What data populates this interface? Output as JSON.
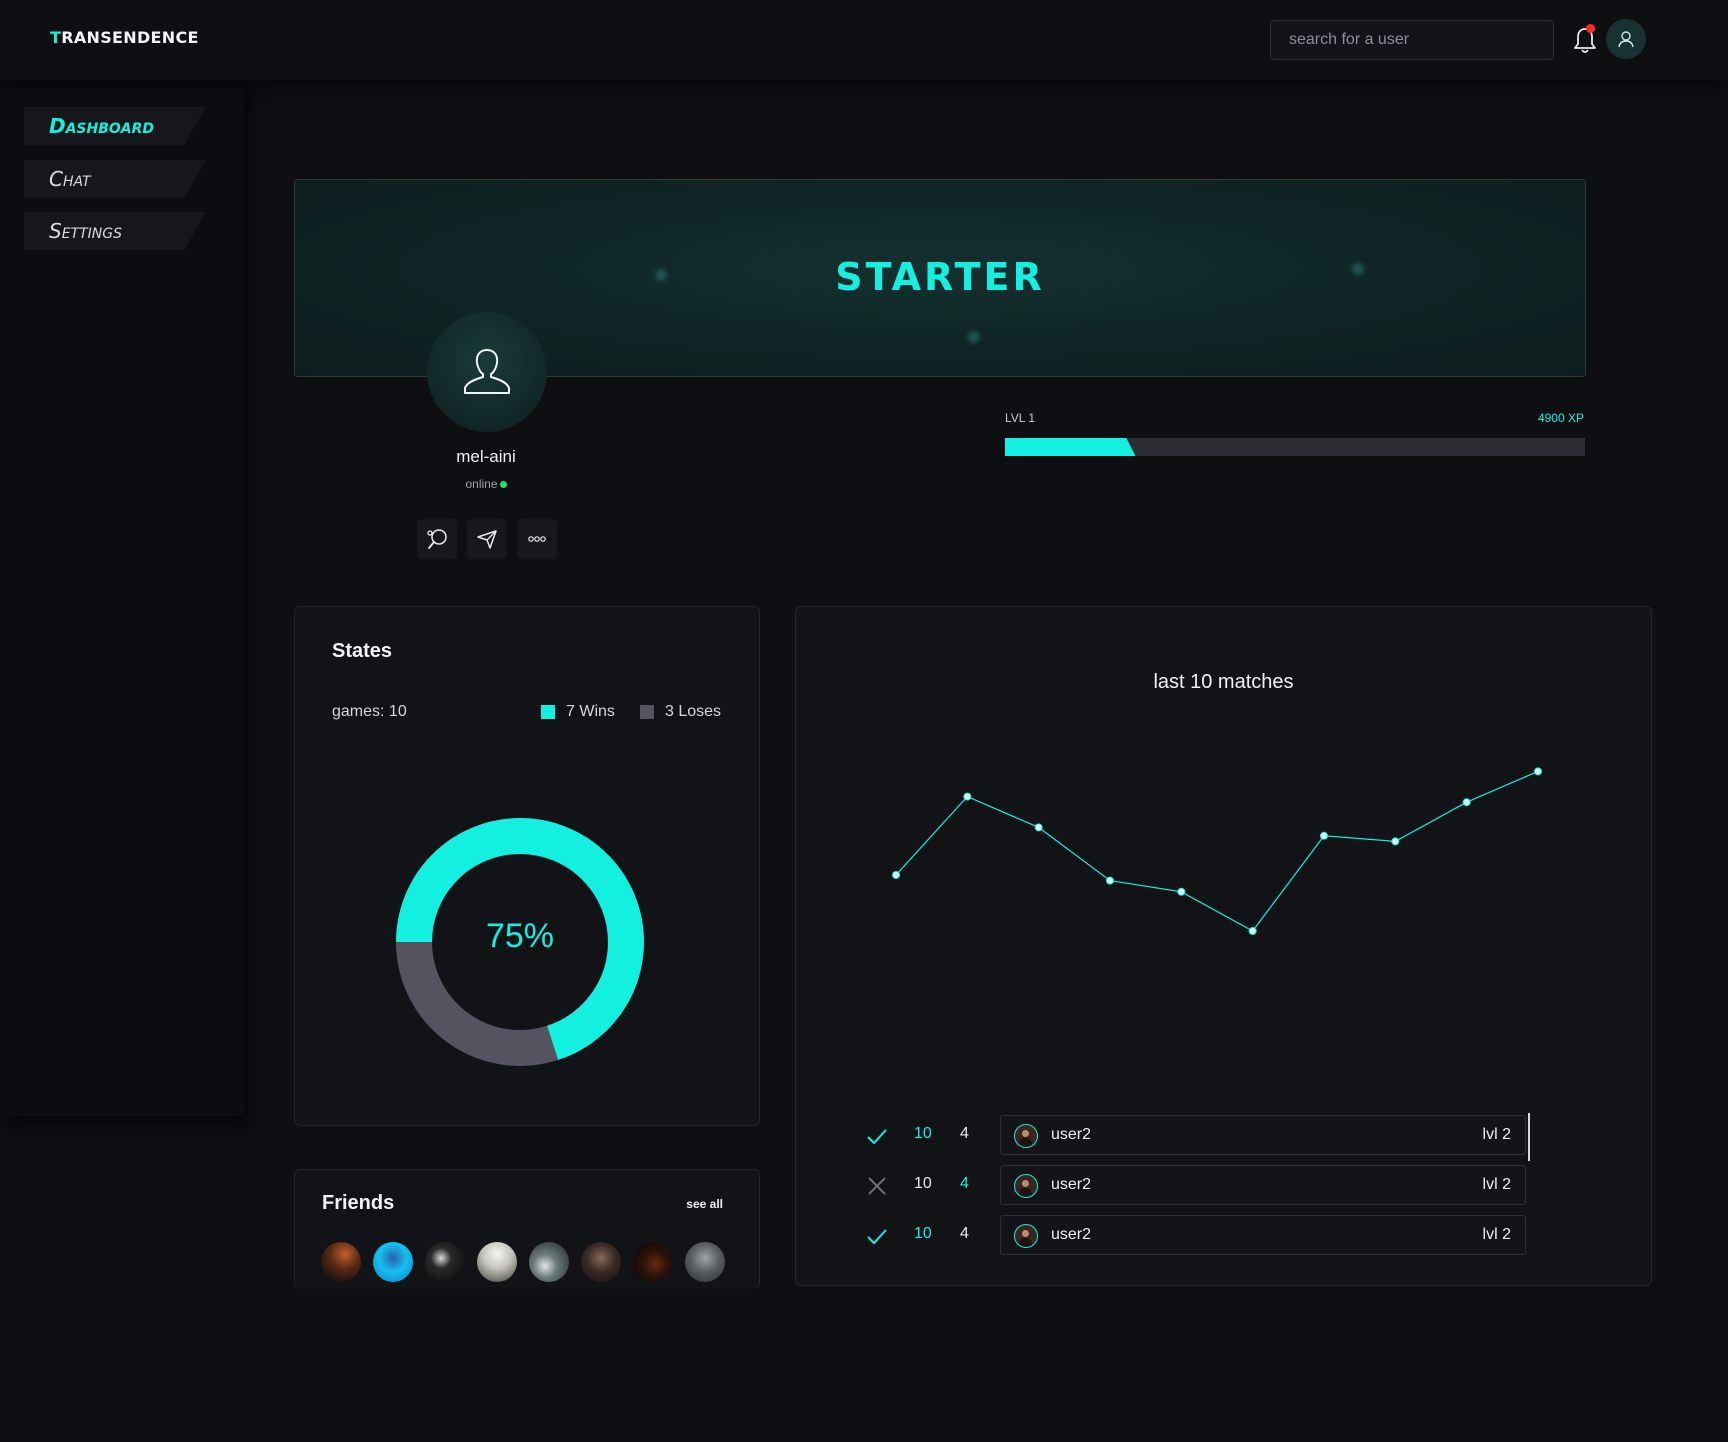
{
  "app": {
    "logo_first": "T",
    "logo_rest": "RANSENDENCE"
  },
  "search": {
    "placeholder": "search for a user"
  },
  "sidebar": {
    "items": [
      {
        "label": "Dashboard",
        "active": true
      },
      {
        "label": "Chat",
        "active": false
      },
      {
        "label": "Settings",
        "active": false
      }
    ]
  },
  "banner": {
    "rank": "STARTER"
  },
  "profile": {
    "username": "mel-aini",
    "status": "online"
  },
  "level": {
    "label": "LVL 1",
    "xp": "4900 XP",
    "progress": 0.225
  },
  "stats": {
    "title": "States",
    "games": "games: 10",
    "wins_label": "7 Wins",
    "loses_label": "3 Loses",
    "percent": "75%",
    "wins_color": "#14f0e0",
    "loses_color": "#55535f"
  },
  "matches": {
    "title": "last 10 matches",
    "rows": [
      {
        "result": "win",
        "score_a": "10",
        "score_b": "4",
        "opponent": "user2",
        "level": "lvl 2"
      },
      {
        "result": "loss",
        "score_a": "10",
        "score_b": "4",
        "opponent": "user2",
        "level": "lvl 2"
      },
      {
        "result": "win",
        "score_a": "10",
        "score_b": "4",
        "opponent": "user2",
        "level": "lvl 2"
      }
    ]
  },
  "friends": {
    "title": "Friends",
    "see_all": "see all"
  },
  "colors": {
    "accent": "#14f0e0",
    "background": "#0e0f12",
    "notification": "#ff2a2a",
    "online": "#1ee06b"
  },
  "chart_data": [
    {
      "type": "pie",
      "title": "",
      "categories": [
        "Wins",
        "Loses"
      ],
      "values": [
        7,
        3
      ],
      "center_label": "75%"
    },
    {
      "type": "line",
      "title": "last 10 matches",
      "x": [
        1,
        2,
        3,
        4,
        5,
        6,
        7,
        8,
        9,
        10
      ],
      "values": [
        40,
        68,
        57,
        38,
        34,
        20,
        54,
        52,
        66,
        77
      ],
      "ylim": [
        0,
        100
      ]
    }
  ]
}
